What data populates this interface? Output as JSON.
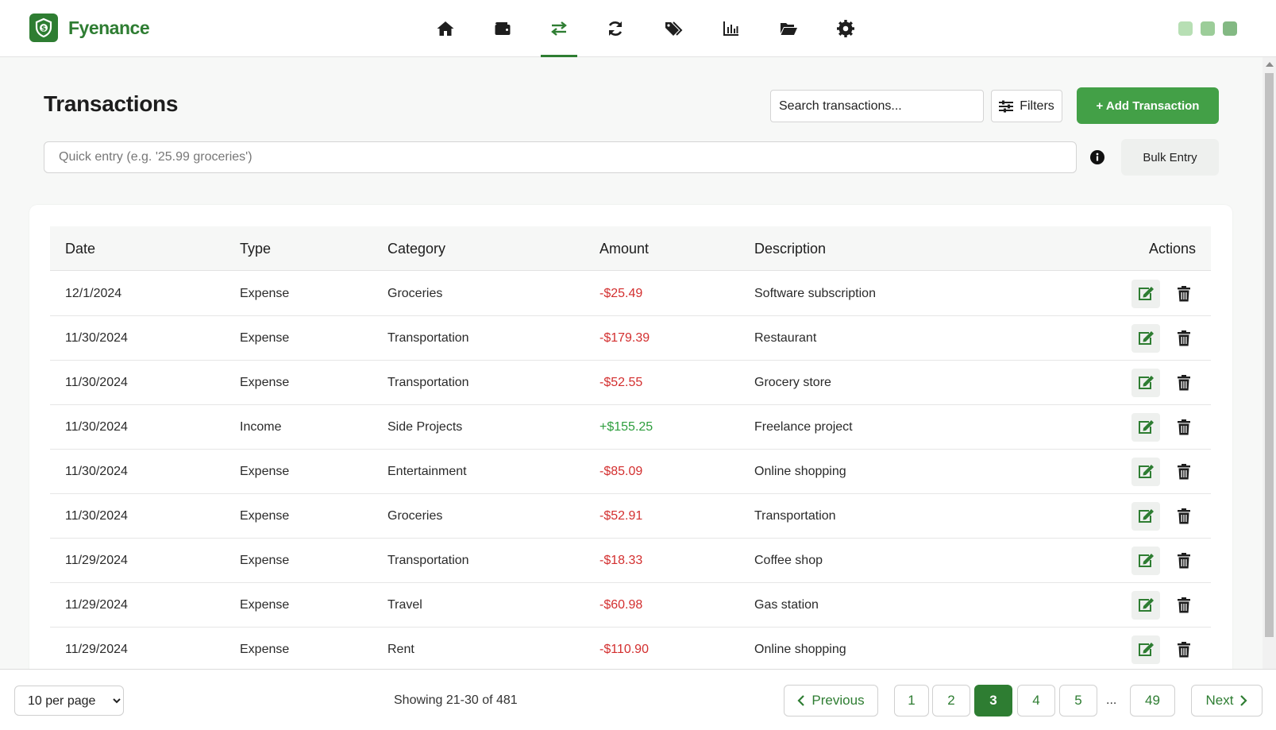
{
  "app": {
    "name": "Fyenance",
    "colors": {
      "brand": "#2e7d32",
      "accent": "#43a047",
      "negative": "#d32f2f",
      "positive": "#2e9e3e"
    }
  },
  "nav": {
    "items": [
      {
        "icon": "home-icon"
      },
      {
        "icon": "wallet-icon"
      },
      {
        "icon": "transfer-arrows-icon",
        "active": true
      },
      {
        "icon": "sync-icon"
      },
      {
        "icon": "tags-icon"
      },
      {
        "icon": "bar-chart-icon"
      },
      {
        "icon": "folder-open-icon"
      },
      {
        "icon": "gear-icon"
      }
    ]
  },
  "header": {
    "title": "Transactions",
    "search_placeholder": "Search transactions...",
    "filters_label": "Filters",
    "add_label": "+ Add Transaction",
    "quick_entry_placeholder": "Quick entry (e.g. '25.99 groceries')",
    "bulk_label": "Bulk Entry"
  },
  "table": {
    "columns": [
      "Date",
      "Type",
      "Category",
      "Amount",
      "Description",
      "Actions"
    ],
    "rows": [
      {
        "date": "12/1/2024",
        "type": "Expense",
        "category": "Groceries",
        "amount": "-$25.49",
        "description": "Software subscription"
      },
      {
        "date": "11/30/2024",
        "type": "Expense",
        "category": "Transportation",
        "amount": "-$179.39",
        "description": "Restaurant"
      },
      {
        "date": "11/30/2024",
        "type": "Expense",
        "category": "Transportation",
        "amount": "-$52.55",
        "description": "Grocery store"
      },
      {
        "date": "11/30/2024",
        "type": "Income",
        "category": "Side Projects",
        "amount": "+$155.25",
        "description": "Freelance project"
      },
      {
        "date": "11/30/2024",
        "type": "Expense",
        "category": "Entertainment",
        "amount": "-$85.09",
        "description": "Online shopping"
      },
      {
        "date": "11/30/2024",
        "type": "Expense",
        "category": "Groceries",
        "amount": "-$52.91",
        "description": "Transportation"
      },
      {
        "date": "11/29/2024",
        "type": "Expense",
        "category": "Transportation",
        "amount": "-$18.33",
        "description": "Coffee shop"
      },
      {
        "date": "11/29/2024",
        "type": "Expense",
        "category": "Travel",
        "amount": "-$60.98",
        "description": "Gas station"
      },
      {
        "date": "11/29/2024",
        "type": "Expense",
        "category": "Rent",
        "amount": "-$110.90",
        "description": "Online shopping"
      }
    ]
  },
  "footer": {
    "per_page": "10 per page",
    "showing": "Showing 21-30 of 481",
    "previous_label": "Previous",
    "next_label": "Next",
    "pages": [
      "1",
      "2",
      "3",
      "4",
      "5"
    ],
    "current_page": "3",
    "ellipsis": "...",
    "last_page": "49"
  }
}
